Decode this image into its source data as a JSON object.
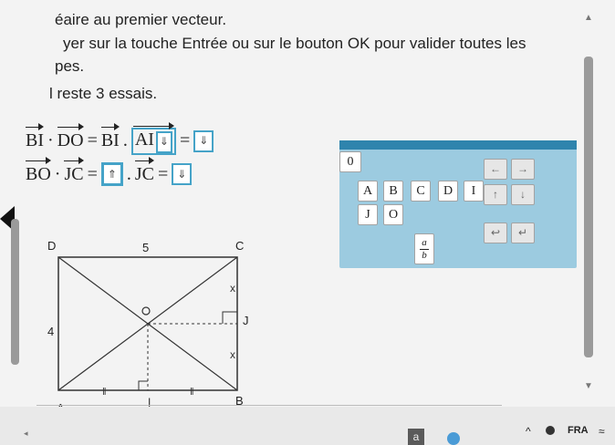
{
  "instructions": {
    "line1": "éaire au premier vecteur.",
    "line2": "yer sur la touche Entrée ou sur le bouton OK pour valider toutes les",
    "line3": "pes.",
    "line4": "l reste 3 essais."
  },
  "question1": {
    "v1": "BI",
    "dot": "·",
    "v2": "DO",
    "eq1": "=",
    "v3": "BI",
    "dot2": ".",
    "v4": "AI",
    "field1_icon": "⇓",
    "eq2": "=",
    "field2_icon": "⇓"
  },
  "question2": {
    "v1": "BO",
    "dot": "·",
    "v2": "JC",
    "eq1": "=",
    "field1_icon": "⇑",
    "dot2": ".",
    "v3": "JC",
    "eq2": "=",
    "field2_icon": "⇓"
  },
  "keypad": {
    "zero": "0",
    "letters_row1": [
      "A",
      "B",
      "C",
      "D",
      "I"
    ],
    "letters_row2": [
      "J",
      "O"
    ],
    "arrow_left": "←",
    "arrow_right": "→",
    "arrow_up": "↑",
    "arrow_down": "↓",
    "undo": "↩",
    "enter": "↵",
    "fraction": {
      "numerator": "a",
      "denominator": "b"
    }
  },
  "diagram": {
    "label_D": "D",
    "label_C": "C",
    "label_A": "A",
    "label_B": "B",
    "label_top": "5",
    "label_left": "4",
    "label_J": "J",
    "label_bottom_tick": "|"
  },
  "taskbar": {
    "app_a": "a",
    "caret": "^",
    "lang": "FRA",
    "wifi": "≈"
  }
}
